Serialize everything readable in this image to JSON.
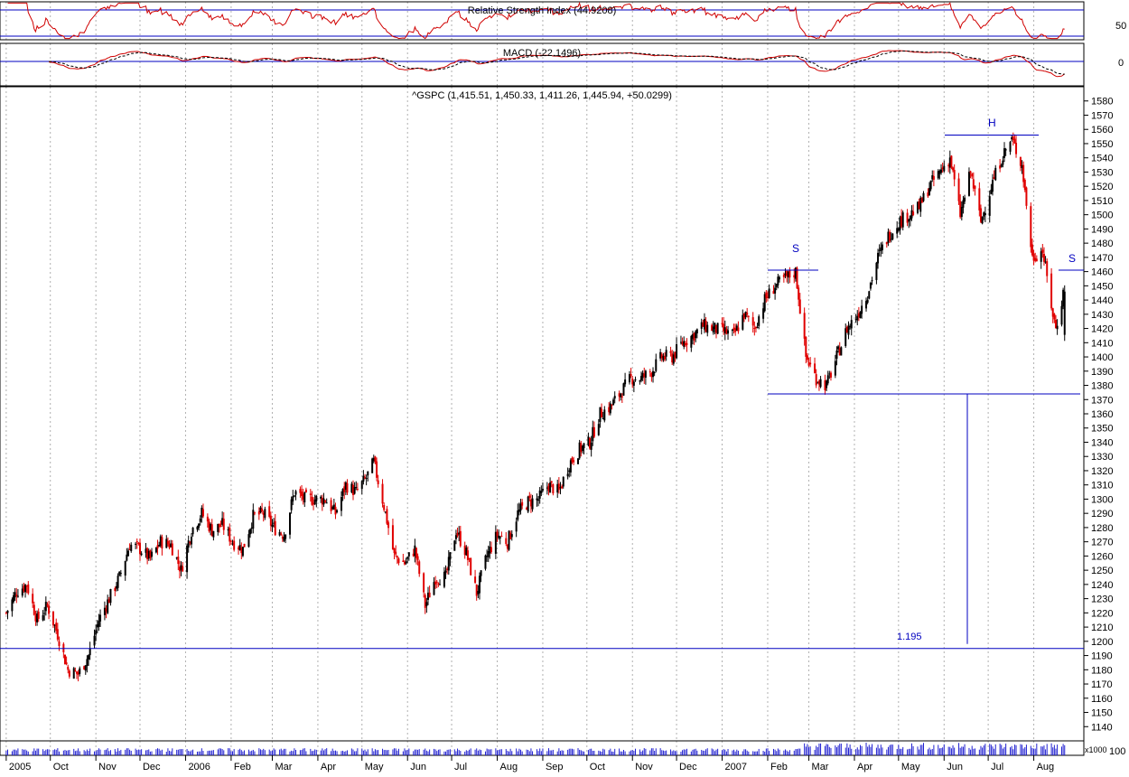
{
  "colors": {
    "up": "#000000",
    "down": "#e00000",
    "rsi": "#d00000",
    "grid": "#b0b0b0",
    "annotation": "#0000c0",
    "volume": "#2020d0",
    "frame": "#000000"
  },
  "rsi_panel": {
    "title": "Relative Strength Index (44.9208)",
    "tick_label": "50",
    "levels": [
      70,
      30
    ],
    "ylim": [
      20,
      80
    ]
  },
  "macd_panel": {
    "title": "MACD (-22.1496)",
    "tick_label": "0",
    "ylim": [
      -30,
      30
    ]
  },
  "price_panel": {
    "title": "^GSPC (1,415.51, 1,450.33, 1,411.26, 1,445.94, +50.0299)",
    "ylim": [
      1130,
      1590
    ],
    "y_ticks": [
      1140,
      1150,
      1160,
      1170,
      1180,
      1190,
      1200,
      1210,
      1220,
      1230,
      1240,
      1250,
      1260,
      1270,
      1280,
      1290,
      1300,
      1310,
      1320,
      1330,
      1340,
      1350,
      1360,
      1370,
      1380,
      1390,
      1400,
      1410,
      1420,
      1430,
      1440,
      1450,
      1460,
      1470,
      1480,
      1490,
      1500,
      1510,
      1520,
      1530,
      1540,
      1550,
      1560,
      1570,
      1580
    ]
  },
  "volume_panel": {
    "unit_label": "x1000",
    "tick_label": "100"
  },
  "x_axis": {
    "labels": [
      "2005",
      "Oct",
      "Nov",
      "Dec",
      "2006",
      "Feb",
      "Mar",
      "Apr",
      "May",
      "Jun",
      "Jul",
      "Aug",
      "Sep",
      "Oct",
      "Nov",
      "Dec",
      "2007",
      "Feb",
      "Mar",
      "Apr",
      "May",
      "Jun",
      "Jul",
      "Aug"
    ]
  },
  "annotations": {
    "support_label": "1.195",
    "shoulder_left": "S",
    "head": "H",
    "shoulder_right": "S"
  },
  "chart_data": {
    "type": "candlestick",
    "title": "^GSPC (1,415.51, 1,450.33, 1,411.26, 1,445.94, +50.0299)",
    "last_bar": {
      "open": 1415.51,
      "high": 1450.33,
      "low": 1411.26,
      "close": 1445.94,
      "change": 50.0299
    },
    "rsi_last": 44.9208,
    "macd_last": -22.1496,
    "price_anchors": [
      [
        "2005-09-01",
        1220
      ],
      [
        "2005-09-08",
        1235
      ],
      [
        "2005-09-15",
        1240
      ],
      [
        "2005-09-22",
        1215
      ],
      [
        "2005-09-29",
        1225
      ],
      [
        "2005-10-06",
        1205
      ],
      [
        "2005-10-13",
        1180
      ],
      [
        "2005-10-20",
        1177
      ],
      [
        "2005-10-27",
        1190
      ],
      [
        "2005-11-03",
        1215
      ],
      [
        "2005-11-10",
        1230
      ],
      [
        "2005-11-17",
        1245
      ],
      [
        "2005-11-24",
        1268
      ],
      [
        "2005-12-01",
        1265
      ],
      [
        "2005-12-08",
        1258
      ],
      [
        "2005-12-15",
        1270
      ],
      [
        "2005-12-22",
        1268
      ],
      [
        "2005-12-29",
        1250
      ],
      [
        "2006-01-05",
        1278
      ],
      [
        "2006-01-12",
        1290
      ],
      [
        "2006-01-19",
        1278
      ],
      [
        "2006-01-26",
        1282
      ],
      [
        "2006-02-02",
        1270
      ],
      [
        "2006-02-09",
        1265
      ],
      [
        "2006-02-16",
        1288
      ],
      [
        "2006-02-23",
        1290
      ],
      [
        "2006-03-02",
        1280
      ],
      [
        "2006-03-09",
        1275
      ],
      [
        "2006-03-16",
        1305
      ],
      [
        "2006-03-23",
        1300
      ],
      [
        "2006-03-30",
        1300
      ],
      [
        "2006-04-06",
        1300
      ],
      [
        "2006-04-13",
        1290
      ],
      [
        "2006-04-20",
        1310
      ],
      [
        "2006-04-27",
        1305
      ],
      [
        "2006-05-04",
        1315
      ],
      [
        "2006-05-09",
        1326
      ],
      [
        "2006-05-16",
        1295
      ],
      [
        "2006-05-23",
        1260
      ],
      [
        "2006-05-30",
        1255
      ],
      [
        "2006-06-06",
        1265
      ],
      [
        "2006-06-13",
        1225
      ],
      [
        "2006-06-20",
        1245
      ],
      [
        "2006-06-27",
        1245
      ],
      [
        "2006-07-04",
        1278
      ],
      [
        "2006-07-11",
        1262
      ],
      [
        "2006-07-18",
        1234
      ],
      [
        "2006-07-25",
        1260
      ],
      [
        "2006-08-01",
        1275
      ],
      [
        "2006-08-08",
        1270
      ],
      [
        "2006-08-15",
        1290
      ],
      [
        "2006-08-22",
        1298
      ],
      [
        "2006-08-29",
        1300
      ],
      [
        "2006-09-05",
        1310
      ],
      [
        "2006-09-12",
        1305
      ],
      [
        "2006-09-19",
        1325
      ],
      [
        "2006-09-26",
        1335
      ],
      [
        "2006-10-03",
        1340
      ],
      [
        "2006-10-10",
        1360
      ],
      [
        "2006-10-17",
        1365
      ],
      [
        "2006-10-24",
        1375
      ],
      [
        "2006-10-31",
        1385
      ],
      [
        "2006-11-07",
        1385
      ],
      [
        "2006-11-14",
        1390
      ],
      [
        "2006-11-21",
        1400
      ],
      [
        "2006-11-28",
        1400
      ],
      [
        "2006-12-05",
        1410
      ],
      [
        "2006-12-12",
        1415
      ],
      [
        "2006-12-19",
        1422
      ],
      [
        "2006-12-26",
        1420
      ],
      [
        "2007-01-02",
        1418
      ],
      [
        "2007-01-09",
        1415
      ],
      [
        "2007-01-16",
        1430
      ],
      [
        "2007-01-23",
        1420
      ],
      [
        "2007-01-30",
        1440
      ],
      [
        "2007-02-06",
        1450
      ],
      [
        "2007-02-13",
        1455
      ],
      [
        "2007-02-20",
        1460
      ],
      [
        "2007-02-27",
        1400
      ],
      [
        "2007-03-06",
        1385
      ],
      [
        "2007-03-13",
        1380
      ],
      [
        "2007-03-20",
        1400
      ],
      [
        "2007-03-27",
        1420
      ],
      [
        "2007-04-03",
        1430
      ],
      [
        "2007-04-10",
        1445
      ],
      [
        "2007-04-17",
        1470
      ],
      [
        "2007-04-24",
        1485
      ],
      [
        "2007-05-01",
        1495
      ],
      [
        "2007-05-08",
        1500
      ],
      [
        "2007-05-15",
        1505
      ],
      [
        "2007-05-22",
        1520
      ],
      [
        "2007-05-29",
        1530
      ],
      [
        "2007-06-05",
        1540
      ],
      [
        "2007-06-12",
        1500
      ],
      [
        "2007-06-19",
        1530
      ],
      [
        "2007-06-26",
        1495
      ],
      [
        "2007-07-03",
        1520
      ],
      [
        "2007-07-10",
        1540
      ],
      [
        "2007-07-17",
        1553
      ],
      [
        "2007-07-24",
        1535
      ],
      [
        "2007-07-31",
        1470
      ],
      [
        "2007-08-07",
        1475
      ],
      [
        "2007-08-14",
        1430
      ],
      [
        "2007-08-16",
        1420
      ],
      [
        "2007-08-21",
        1445
      ]
    ],
    "pattern": {
      "left_shoulder": 1461,
      "head": 1556,
      "right_shoulder": 1461,
      "neckline": 1374,
      "target": 1195
    }
  }
}
